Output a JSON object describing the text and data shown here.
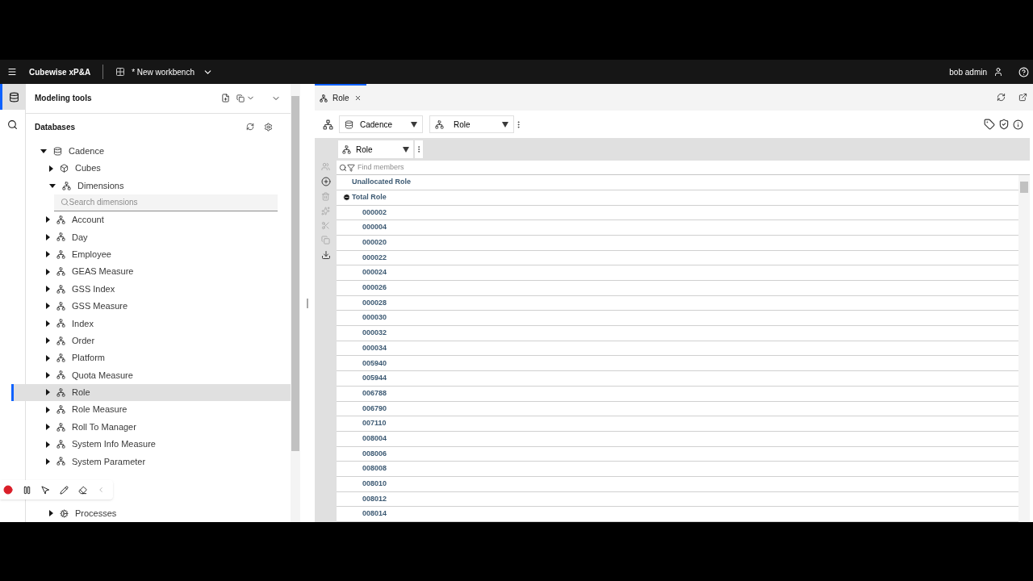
{
  "header": {
    "brand": "Cubewise xP&A",
    "workbench": "* New workbench",
    "user": "bob admin"
  },
  "left_panel": {
    "title": "Modeling tools",
    "section": "Databases",
    "tree": [
      {
        "label": "Cadence",
        "kind": "database",
        "expanded": true,
        "children": [
          {
            "label": "Cubes",
            "kind": "cubes",
            "expanded": false
          },
          {
            "label": "Dimensions",
            "kind": "dimensions",
            "expanded": true,
            "search_placeholder": "Search dimensions",
            "children": [
              {
                "label": "Account",
                "selected": false
              },
              {
                "label": "Day",
                "selected": false
              },
              {
                "label": "Employee",
                "selected": false
              },
              {
                "label": "GEAS Measure",
                "selected": false
              },
              {
                "label": "GSS Index",
                "selected": false
              },
              {
                "label": "GSS Measure",
                "selected": false
              },
              {
                "label": "Index",
                "selected": false
              },
              {
                "label": "Order",
                "selected": false
              },
              {
                "label": "Platform",
                "selected": false
              },
              {
                "label": "Quota Measure",
                "selected": false
              },
              {
                "label": "Role",
                "selected": true
              },
              {
                "label": "Role Measure",
                "selected": false
              },
              {
                "label": "Roll To Manager",
                "selected": false
              },
              {
                "label": "System Info Measure",
                "selected": false
              },
              {
                "label": "System Parameter",
                "selected": false
              }
            ]
          },
          {
            "label": "Processes",
            "kind": "processes",
            "expanded": false
          }
        ]
      }
    ]
  },
  "tabs": [
    {
      "label": "Role",
      "selected": true
    }
  ],
  "editor": {
    "database": "Cadence",
    "dimension": "Role",
    "hierarchy": "Role",
    "find_placeholder": "Find members",
    "members": [
      {
        "label": "Unallocated Role",
        "kind": "top"
      },
      {
        "label": "Total Role",
        "kind": "consolidated",
        "expanded": true
      },
      {
        "label": "000002",
        "kind": "leaf"
      },
      {
        "label": "000004",
        "kind": "leaf"
      },
      {
        "label": "000020",
        "kind": "leaf"
      },
      {
        "label": "000022",
        "kind": "leaf"
      },
      {
        "label": "000024",
        "kind": "leaf"
      },
      {
        "label": "000026",
        "kind": "leaf"
      },
      {
        "label": "000028",
        "kind": "leaf"
      },
      {
        "label": "000030",
        "kind": "leaf"
      },
      {
        "label": "000032",
        "kind": "leaf"
      },
      {
        "label": "000034",
        "kind": "leaf"
      },
      {
        "label": "005940",
        "kind": "leaf"
      },
      {
        "label": "005944",
        "kind": "leaf"
      },
      {
        "label": "006788",
        "kind": "leaf"
      },
      {
        "label": "006790",
        "kind": "leaf"
      },
      {
        "label": "007110",
        "kind": "leaf"
      },
      {
        "label": "008004",
        "kind": "leaf"
      },
      {
        "label": "008006",
        "kind": "leaf"
      },
      {
        "label": "008008",
        "kind": "leaf"
      },
      {
        "label": "008010",
        "kind": "leaf"
      },
      {
        "label": "008012",
        "kind": "leaf"
      },
      {
        "label": "008014",
        "kind": "leaf"
      }
    ]
  }
}
